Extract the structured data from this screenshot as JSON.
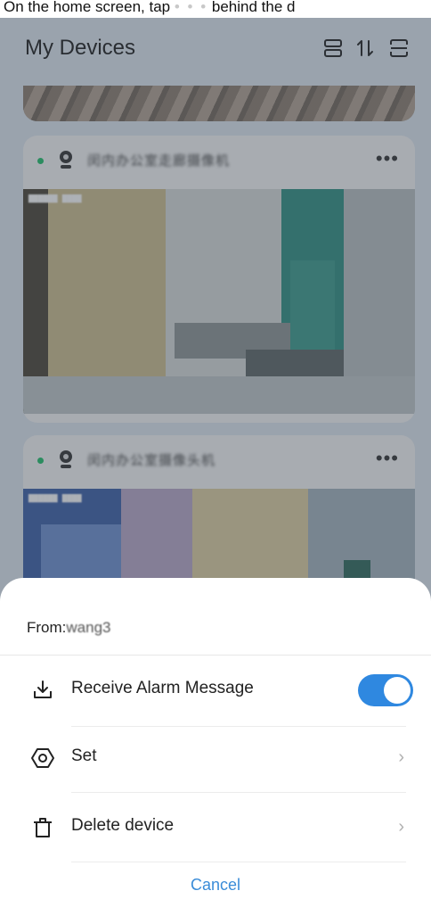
{
  "instruction": {
    "text_before": "On the home screen, tap",
    "dots": "• • •",
    "text_after": "behind the d"
  },
  "header": {
    "title": "My Devices",
    "icons": [
      "list-view-icon",
      "sort-icon",
      "scan-icon"
    ]
  },
  "devices": [
    {
      "name": "闵内办公室走廊摄像机",
      "status": "online"
    },
    {
      "name": "闵内办公室摄像头机",
      "status": "online"
    }
  ],
  "sheet": {
    "from_label": "From:",
    "from_user": "wang3",
    "items": [
      {
        "label": "Receive Alarm Message",
        "icon": "download-tray-icon",
        "control": "toggle",
        "toggle_on": true
      },
      {
        "label": "Set",
        "icon": "settings-ring-icon",
        "control": "chevron"
      },
      {
        "label": "Delete device",
        "icon": "trash-icon",
        "control": "chevron"
      }
    ],
    "cancel_label": "Cancel"
  },
  "colors": {
    "accent": "#2f88e0",
    "cancel_text": "#3a8cd8",
    "online": "#1fbf6a"
  }
}
